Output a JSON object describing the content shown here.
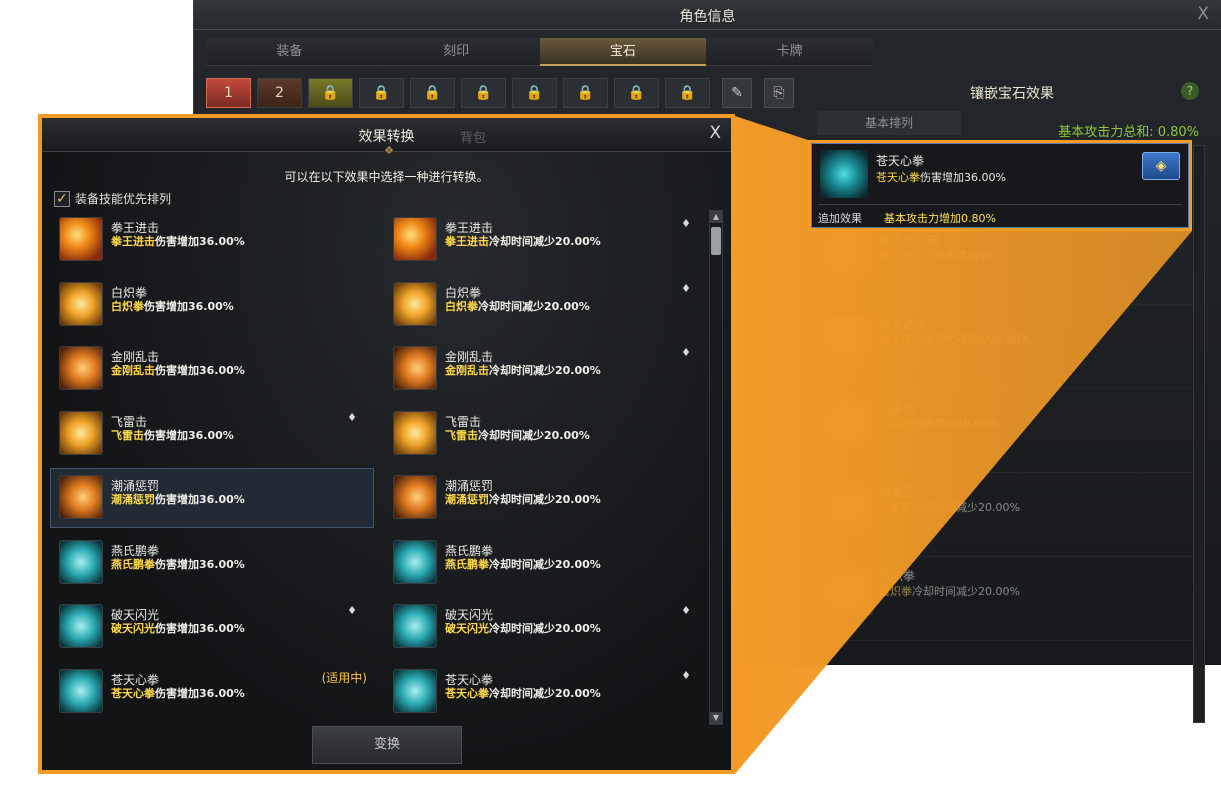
{
  "back_window": {
    "title": "角色信息",
    "close": "X",
    "tabs": [
      "装备",
      "刻印",
      "宝石",
      "卡牌"
    ],
    "active_tab": "宝石",
    "slots": [
      "1",
      "2"
    ],
    "right_panel": {
      "title": "镶嵌宝石效果",
      "help": "?",
      "sort_label": "基本排列",
      "total": "基本攻击力总和: 0.80%",
      "items": [
        {
          "name": "拳王十二式",
          "desc_hl": "拳王十二式",
          "desc_rest": "伤害增加40..."
        },
        {
          "name": "拳王进击",
          "desc_hl": "拳王进击",
          "desc_rest": "冷却时间减少20.00%"
        },
        {
          "name": "飞雷击",
          "desc_hl": "飞雷击",
          "desc_rest": "伤害增加40.00%"
        },
        {
          "name": "流星坠",
          "desc_hl": "流星坠",
          "desc_rest": "冷却时间减少20.00%"
        },
        {
          "name": "白炽拳",
          "desc_hl": "白炽拳",
          "desc_rest": "冷却时间减少20.00%"
        }
      ]
    }
  },
  "highlight_card": {
    "name": "苍天心拳",
    "desc_hl": "苍天心拳",
    "desc_rest": "伤害增加36.00%",
    "extra_label": "追加效果",
    "extra_value": "基本攻击力增加0.80%",
    "button_icon": "gem-convert-icon"
  },
  "dialog": {
    "title": "效果转换",
    "ghost_tab": "背包",
    "close": "X",
    "subtitle": "可以在以下效果中选择一种进行转换。",
    "checkbox_label": "装备技能优先排列",
    "checkbox_checked": true,
    "convert_button": "变换",
    "options": [
      {
        "name": "拳王进击",
        "hl": "拳王进击",
        "rest": "伤害增加36.00%",
        "icon": "fire",
        "gem": false,
        "status": ""
      },
      {
        "name": "拳王进击",
        "hl": "拳王进击",
        "rest": "冷却时间减少20.00%",
        "icon": "fire",
        "gem": true,
        "status": ""
      },
      {
        "name": "白炽拳",
        "hl": "白炽拳",
        "rest": "伤害增加36.00%",
        "icon": "gold",
        "gem": false,
        "status": ""
      },
      {
        "name": "白炽拳",
        "hl": "白炽拳",
        "rest": "冷却时间减少20.00%",
        "icon": "gold",
        "gem": true,
        "status": ""
      },
      {
        "name": "金刚乱击",
        "hl": "金刚乱击",
        "rest": "伤害增加36.00%",
        "icon": "burst",
        "gem": false,
        "status": ""
      },
      {
        "name": "金刚乱击",
        "hl": "金刚乱击",
        "rest": "冷却时间减少20.00%",
        "icon": "burst",
        "gem": true,
        "status": ""
      },
      {
        "name": "飞雷击",
        "hl": "飞雷击",
        "rest": "伤害增加36.00%",
        "icon": "gold",
        "gem": true,
        "status": ""
      },
      {
        "name": "飞雷击",
        "hl": "飞雷击",
        "rest": "冷却时间减少20.00%",
        "icon": "gold",
        "gem": false,
        "status": ""
      },
      {
        "name": "潮涌惩罚",
        "hl": "潮涌惩罚",
        "rest": "伤害增加36.00%",
        "icon": "burst",
        "gem": false,
        "status": "",
        "selected": true
      },
      {
        "name": "潮涌惩罚",
        "hl": "潮涌惩罚",
        "rest": "冷却时间减少20.00%",
        "icon": "burst",
        "gem": false,
        "status": ""
      },
      {
        "name": "燕氏鹏拳",
        "hl": "燕氏鹏拳",
        "rest": "伤害增加36.00%",
        "icon": "teal",
        "gem": false,
        "status": ""
      },
      {
        "name": "燕氏鹏拳",
        "hl": "燕氏鹏拳",
        "rest": "冷却时间减少20.00%",
        "icon": "teal",
        "gem": false,
        "status": ""
      },
      {
        "name": "破天闪光",
        "hl": "破天闪光",
        "rest": "伤害增加36.00%",
        "icon": "teal",
        "gem": true,
        "status": ""
      },
      {
        "name": "破天闪光",
        "hl": "破天闪光",
        "rest": "冷却时间减少20.00%",
        "icon": "teal",
        "gem": true,
        "status": ""
      },
      {
        "name": "苍天心拳",
        "hl": "苍天心拳",
        "rest": "伤害增加36.00%",
        "icon": "teal",
        "gem": false,
        "status": "(适用中)"
      },
      {
        "name": "苍天心拳",
        "hl": "苍天心拳",
        "rest": "冷却时间减少20.00%",
        "icon": "teal",
        "gem": true,
        "status": ""
      }
    ]
  },
  "colors": {
    "accent_orange": "#f39a27",
    "highlight_text": "#ffd94a",
    "green_text": "#90c83a"
  }
}
